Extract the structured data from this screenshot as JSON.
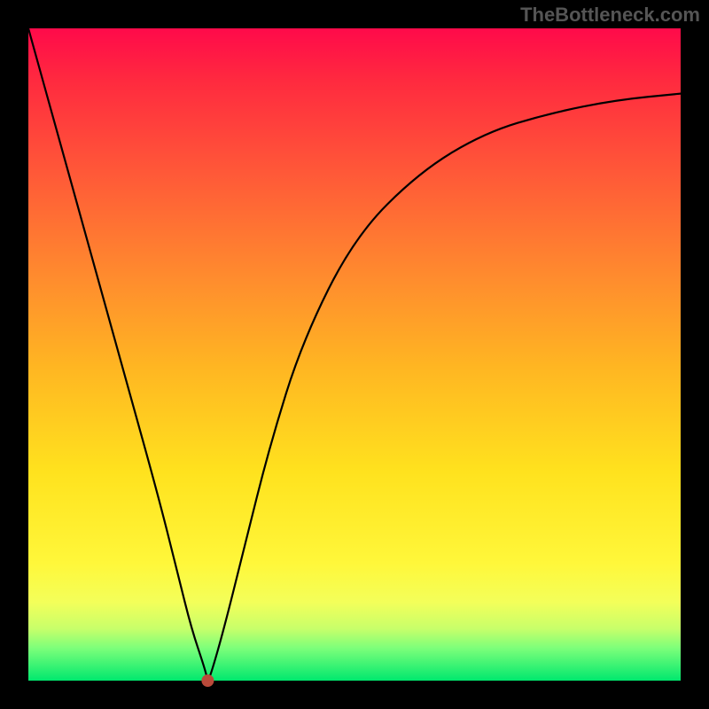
{
  "watermark": "TheBottleneck.com",
  "chart_data": {
    "type": "line",
    "title": "",
    "xlabel": "",
    "ylabel": "",
    "xlim": [
      0,
      100
    ],
    "ylim": [
      0,
      100
    ],
    "background_gradient": {
      "direction": "vertical",
      "stops": [
        {
          "pos": 0,
          "color": "#ff0a4a"
        },
        {
          "pos": 22,
          "color": "#ff5838"
        },
        {
          "pos": 52,
          "color": "#ffb622"
        },
        {
          "pos": 82,
          "color": "#fff73a"
        },
        {
          "pos": 95,
          "color": "#7dff7a"
        },
        {
          "pos": 100,
          "color": "#00e86e"
        }
      ]
    },
    "series": [
      {
        "name": "bottleneck-curve",
        "x": [
          0,
          5,
          10,
          15,
          20,
          23,
          25,
          27,
          27.5,
          28,
          30,
          33,
          37,
          42,
          50,
          60,
          70,
          80,
          90,
          100
        ],
        "y": [
          100,
          82,
          64,
          46,
          28,
          16,
          8,
          2,
          0,
          1,
          8,
          20,
          36,
          52,
          68,
          78,
          84,
          87,
          89,
          90
        ]
      }
    ],
    "annotations": [
      {
        "type": "point",
        "name": "minimum-marker",
        "x": 27.5,
        "y": 0,
        "color": "#b94a3a"
      }
    ]
  }
}
